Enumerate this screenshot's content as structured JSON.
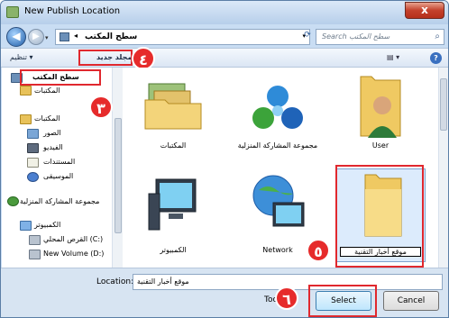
{
  "window": {
    "title": "New Publish Location",
    "close_label": "x"
  },
  "address": {
    "path": "سطح المكتب",
    "search_placeholder": "Search سطح المكتب"
  },
  "toolbar": {
    "organize": "تنظيم ▾",
    "new_folder": "مجلد جديد"
  },
  "badges": {
    "b3": "٣",
    "b4": "٤",
    "b5": "٥",
    "b6": "٦"
  },
  "sidebar": {
    "desktop": "سطح المكتب",
    "libraries1": "المكتبات",
    "libraries2": "المكتبات",
    "pictures": "الصور",
    "videos": "الفيديو",
    "documents": "المستندات",
    "music": "الموسيقى",
    "homegroup": "مجموعة المشاركة المنزلية",
    "computer": "الكمبيوتر",
    "local_disk": "القرص المحلي (C:)",
    "new_volume": "New Volume (D:)"
  },
  "items": {
    "libraries": "المكتبات",
    "homegroup": "مجموعة المشاركة المنزلية",
    "user": "User",
    "computer": "الكمبيوتر",
    "network": "Network",
    "folder": "موقع أخبار التقنية"
  },
  "footer": {
    "location_label": "Location:",
    "location_value": "موقع أخبار التقنية",
    "tools": "Tools",
    "select": "Select",
    "cancel": "Cancel"
  },
  "colors": {
    "highlight": "#e0282e",
    "accent": "#1f5ea8"
  }
}
